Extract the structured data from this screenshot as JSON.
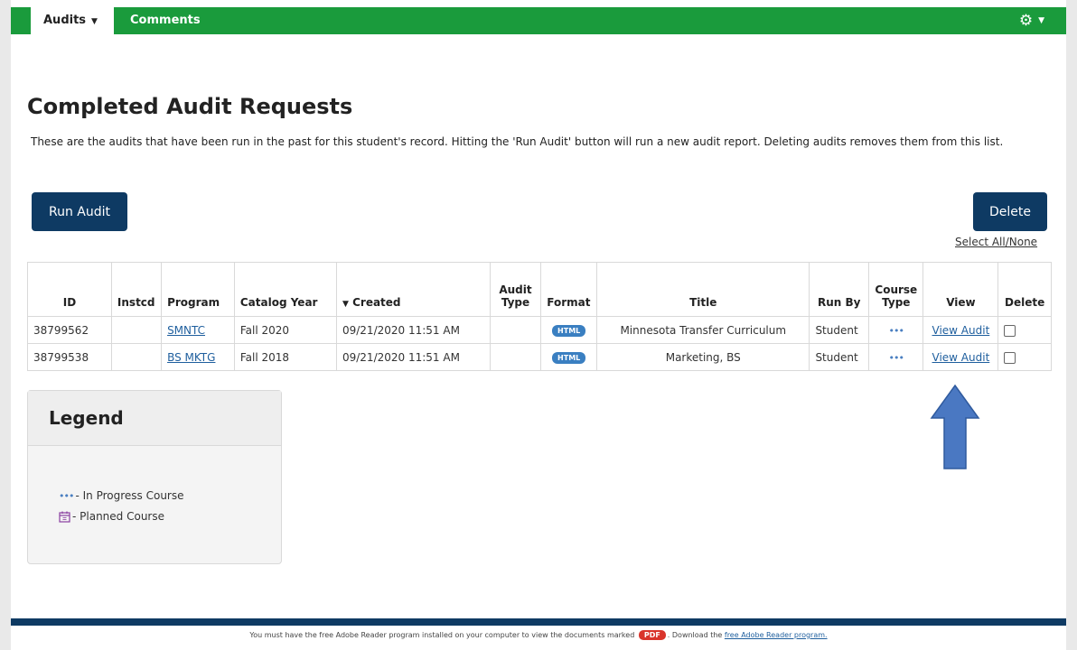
{
  "nav": {
    "audits_tab": "Audits",
    "comments_tab": "Comments"
  },
  "page": {
    "title": "Completed Audit Requests",
    "description": "These are the audits that have been run in the past for this student's record. Hitting the 'Run Audit' button will run a new audit report. Deleting audits removes them from this list."
  },
  "actions": {
    "run_audit": "Run Audit",
    "delete": "Delete",
    "select_all": "Select All/None"
  },
  "table": {
    "headers": {
      "id": "ID",
      "instcd": "Instcd",
      "program": "Program",
      "catalog_year": "Catalog Year",
      "created": "Created",
      "audit_type_1": "Audit",
      "audit_type_2": "Type",
      "format": "Format",
      "title": "Title",
      "run_by": "Run By",
      "course_type_1": "Course",
      "course_type_2": "Type",
      "view": "View",
      "delete": "Delete"
    },
    "rows": [
      {
        "id": "38799562",
        "instcd": "",
        "program": "SMNTC",
        "catalog_year": "Fall 2020",
        "created": "09/21/2020 11:51 AM",
        "audit_type": "",
        "format": "HTML",
        "title": "Minnesota Transfer Curriculum",
        "run_by": "Student",
        "course_type": "•••",
        "view": "View Audit"
      },
      {
        "id": "38799538",
        "instcd": "",
        "program": "BS MKTG",
        "catalog_year": "Fall 2018",
        "created": "09/21/2020 11:51 AM",
        "audit_type": "",
        "format": "HTML",
        "title": "Marketing, BS",
        "run_by": "Student",
        "course_type": "•••",
        "view": "View Audit"
      }
    ]
  },
  "legend": {
    "title": "Legend",
    "in_progress_icon": "•••",
    "in_progress": "- In Progress Course",
    "planned": "- Planned Course"
  },
  "footer": {
    "text_before": "You must have the free Adobe Reader program installed on your computer to view the documents marked",
    "pdf_badge": "PDF",
    "text_middle": ". Download the",
    "link": "free Adobe Reader program."
  },
  "colors": {
    "nav_green": "#1a9b3c",
    "button_navy": "#0e3a63",
    "html_badge": "#3a7fc1",
    "pdf_badge": "#d9342b",
    "arrow": "#4a78c2"
  }
}
